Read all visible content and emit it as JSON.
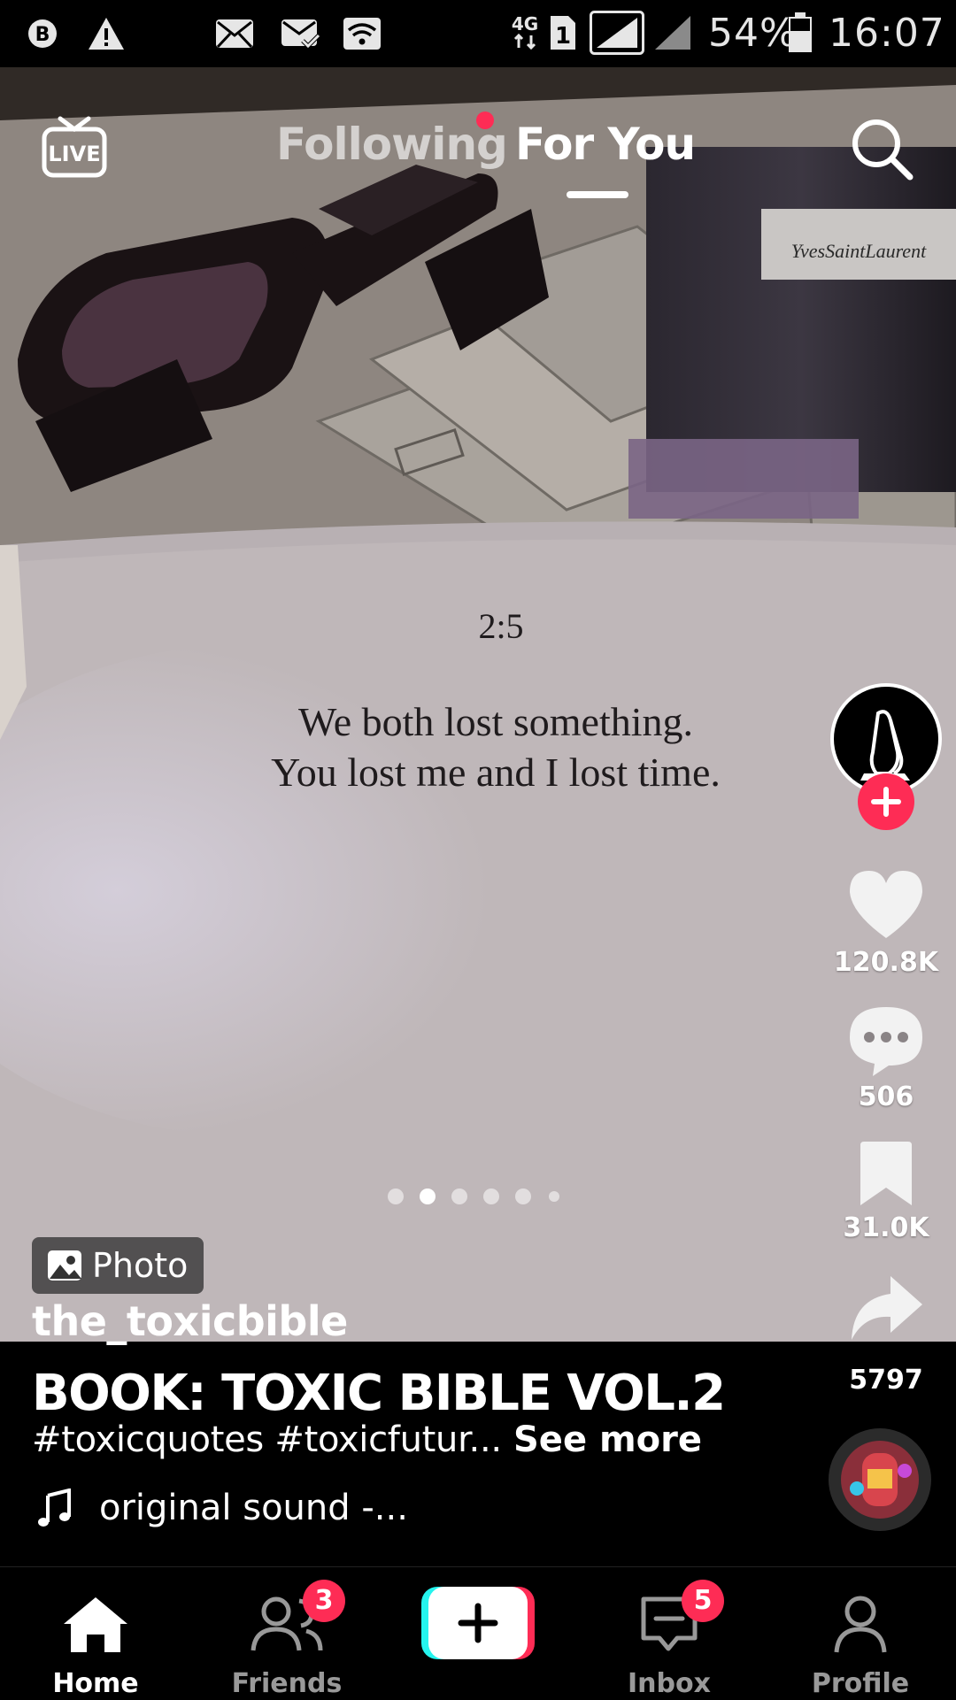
{
  "status_bar": {
    "left_icons": [
      "b-circle-icon",
      "warning-icon",
      "mail-icon",
      "mail-check-icon",
      "wifi-icon"
    ],
    "network": "4G",
    "sim": "1",
    "battery": "54%",
    "time": "16:07"
  },
  "top_nav": {
    "live_label": "LIVE",
    "tabs": [
      {
        "label": "Following",
        "active": false,
        "has_dot": true
      },
      {
        "label": "For You",
        "active": true
      }
    ]
  },
  "photo": {
    "page_number": "2:5",
    "quote_line1": "We both lost something.",
    "quote_line2": "You lost me and I lost time.",
    "bottle_label": "YvesSaintLaurent",
    "carousel": {
      "count": 6,
      "active_index": 1
    }
  },
  "actions": {
    "likes": "120.8K",
    "comments": "506",
    "saves": "31.0K",
    "shares": "5797"
  },
  "post": {
    "badge": "Photo",
    "username": "the_toxicbible",
    "title": "BOOK: TOXIC BIBLE VOL.2",
    "tags": "#toxicquotes #toxicfutur...",
    "see_more": "See more",
    "sound": "original sound -..."
  },
  "bottom_nav": {
    "items": [
      {
        "label": "Home",
        "active": true
      },
      {
        "label": "Friends",
        "badge": "3"
      },
      {
        "label": "Inbox",
        "badge": "5"
      },
      {
        "label": "Profile"
      }
    ]
  },
  "colors": {
    "accent": "#fe2c55",
    "create_cyan": "#25f4ee",
    "background": "#000000"
  }
}
